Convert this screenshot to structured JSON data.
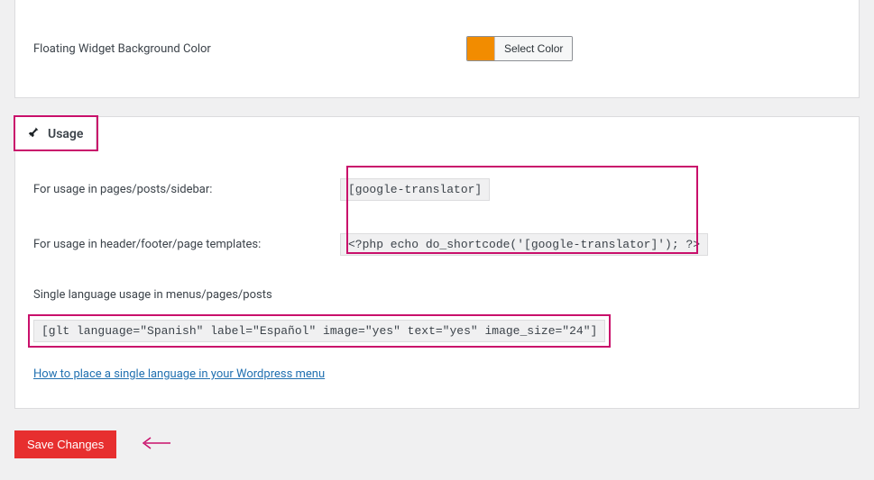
{
  "top_panel": {
    "floating_bg_label": "Floating Widget Background Color",
    "select_color_btn": "Select Color",
    "swatch_color": "#f28c00"
  },
  "usage": {
    "tab_title": "Usage",
    "row1_label": "For usage in pages/posts/sidebar:",
    "row1_code": "[google-translator]",
    "row2_label": "For usage in header/footer/page templates:",
    "row2_code": "<?php echo do_shortcode('[google-translator]'); ?>",
    "single_lang_label": "Single language usage in menus/pages/posts",
    "single_lang_code": "[glt language=\"Spanish\" label=\"Español\" image=\"yes\" text=\"yes\" image_size=\"24\"]",
    "help_link": "How to place a single language in your Wordpress menu"
  },
  "save_button": "Save Changes"
}
